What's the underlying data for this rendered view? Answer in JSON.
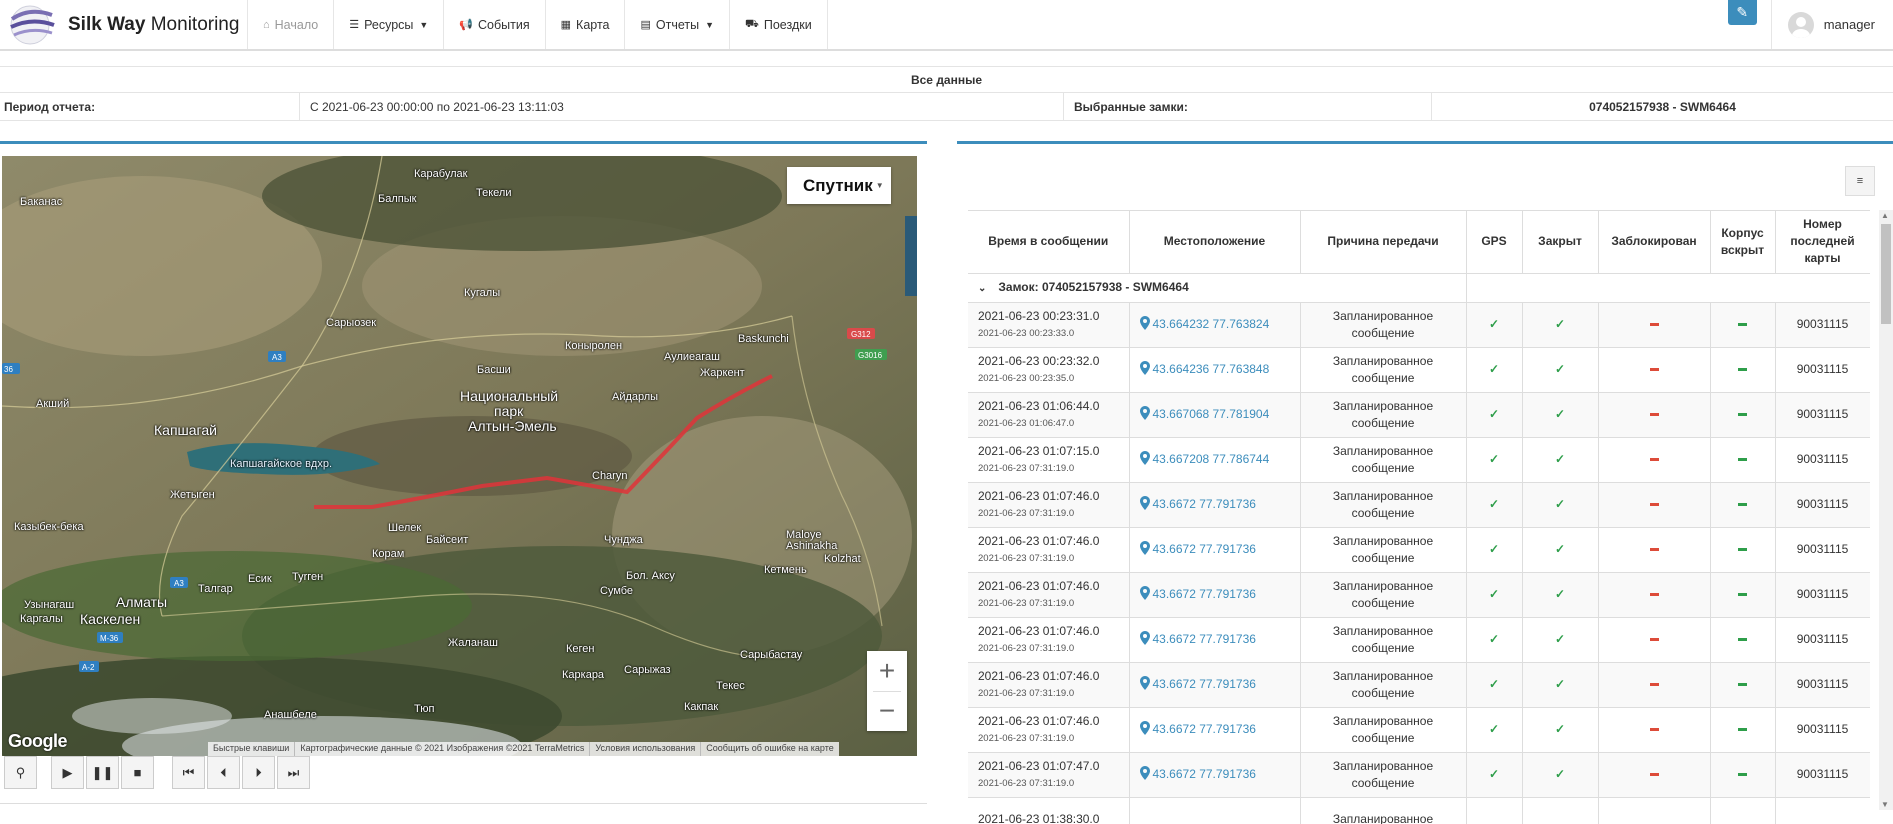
{
  "app": {
    "brand_bold": "Silk Way",
    "brand_rest": " Monitoring"
  },
  "nav": {
    "home": "Начало",
    "resources": "Ресурсы",
    "events": "События",
    "map": "Карта",
    "reports": "Отчеты",
    "trips": "Поездки"
  },
  "user": {
    "name": "manager"
  },
  "report": {
    "heading": "Все данные",
    "period_label": "Период отчета:",
    "period_value": "С 2021-06-23 00:00:00 по 2021-06-23 13:11:03",
    "locks_label": "Выбранные замки:",
    "locks_value": "074052157938 - SWM6464"
  },
  "map": {
    "type_label": "Спутник",
    "zoom_in": "+",
    "zoom_out": "−",
    "google": "Google",
    "attribution": [
      "Быстрые клавиши",
      "Картографические данные © 2021 Изображения ©2021 TerraMetrics",
      "Условия использования",
      "Сообщить об ошибке на карте"
    ],
    "labels": {
      "l1": "Карабулак",
      "l2": "Балпык",
      "l3": "Текели",
      "l4": "Баканас",
      "l5": "Кугалы",
      "l6": "Сарыозек",
      "l7": "Коныролен",
      "l8": "Аулиеагаш",
      "l9": "Baskunchi",
      "l10": "Жаркент",
      "l11": "Басши",
      "l12": "Айдарлы",
      "l13": "Национальный",
      "l14": "парк",
      "l15": "Алтын-Эмель",
      "l16": "Капшагай",
      "l17": "Акший",
      "l18": "Капшагайское вдхр.",
      "l19": "Жетыген",
      "l20": "Казыбек-бека",
      "l21": "Шелек",
      "l22": "Байсеит",
      "l23": "Charyn",
      "l24": "Чунджа",
      "l25": "Корам",
      "l26": "Maloye Ashinakha",
      "l27": "Kolzhat",
      "l28": "Туrген",
      "l29": "Есик",
      "l30": "Талгар",
      "l31": "Кетмень",
      "l32": "Бол. Аксу",
      "l33": "Сумбе",
      "l34": "Алматы",
      "l35": "Узынагаш",
      "l36": "Каргалы",
      "l37": "Каскелен",
      "l38": "Жаланаш",
      "l39": "Кеген",
      "l40": "Каркара",
      "l41": "Сарыжаз",
      "l42": "Сарыбастау",
      "l43": "Текес",
      "l44": "Какпак",
      "l45": "Тюп",
      "l46": "Анашбеле"
    },
    "road_badges": [
      "A3",
      "A3",
      "M-36",
      "A-2",
      "G312",
      "G3016",
      "36"
    ]
  },
  "player": {
    "buttons": [
      "pin",
      "play",
      "pause",
      "stop",
      "first",
      "prev",
      "next",
      "last"
    ]
  },
  "table": {
    "columns": [
      "Время в сообщении",
      "Местоположение",
      "Причина передачи",
      "GPS",
      "Закрыт",
      "Заблокирован",
      "Корпус вскрыт",
      "Номер последней карты"
    ],
    "group_label": "Замок: 074052157938 - SWM6464",
    "rows": [
      {
        "t1": "2021-06-23 00:23:31.0",
        "t2": "2021-06-23 00:23:33.0",
        "loc": "43.664232 77.763824",
        "reason1": "Запланированное",
        "reason2": "сообщение",
        "card": "90031115"
      },
      {
        "t1": "2021-06-23 00:23:32.0",
        "t2": "2021-06-23 00:23:35.0",
        "loc": "43.664236 77.763848",
        "reason1": "Запланированное",
        "reason2": "сообщение",
        "card": "90031115"
      },
      {
        "t1": "2021-06-23 01:06:44.0",
        "t2": "2021-06-23 01:06:47.0",
        "loc": "43.667068 77.781904",
        "reason1": "Запланированное",
        "reason2": "сообщение",
        "card": "90031115"
      },
      {
        "t1": "2021-06-23 01:07:15.0",
        "t2": "2021-06-23 07:31:19.0",
        "loc": "43.667208 77.786744",
        "reason1": "Запланированное",
        "reason2": "сообщение",
        "card": "90031115"
      },
      {
        "t1": "2021-06-23 01:07:46.0",
        "t2": "2021-06-23 07:31:19.0",
        "loc": "43.6672 77.791736",
        "reason1": "Запланированное",
        "reason2": "сообщение",
        "card": "90031115"
      },
      {
        "t1": "2021-06-23 01:07:46.0",
        "t2": "2021-06-23 07:31:19.0",
        "loc": "43.6672 77.791736",
        "reason1": "Запланированное",
        "reason2": "сообщение",
        "card": "90031115"
      },
      {
        "t1": "2021-06-23 01:07:46.0",
        "t2": "2021-06-23 07:31:19.0",
        "loc": "43.6672 77.791736",
        "reason1": "Запланированное",
        "reason2": "сообщение",
        "card": "90031115"
      },
      {
        "t1": "2021-06-23 01:07:46.0",
        "t2": "2021-06-23 07:31:19.0",
        "loc": "43.6672 77.791736",
        "reason1": "Запланированное",
        "reason2": "сообщение",
        "card": "90031115"
      },
      {
        "t1": "2021-06-23 01:07:46.0",
        "t2": "2021-06-23 07:31:19.0",
        "loc": "43.6672 77.791736",
        "reason1": "Запланированное",
        "reason2": "сообщение",
        "card": "90031115"
      },
      {
        "t1": "2021-06-23 01:07:46.0",
        "t2": "2021-06-23 07:31:19.0",
        "loc": "43.6672 77.791736",
        "reason1": "Запланированное",
        "reason2": "сообщение",
        "card": "90031115"
      },
      {
        "t1": "2021-06-23 01:07:47.0",
        "t2": "2021-06-23 07:31:19.0",
        "loc": "43.6672 77.791736",
        "reason1": "Запланированное",
        "reason2": "сообщение",
        "card": "90031115"
      },
      {
        "t1": "2021-06-23 01:38:30.0",
        "t2": "",
        "loc": "",
        "reason1": "Запланированное",
        "reason2": "",
        "card": ""
      }
    ]
  },
  "colors": {
    "accent": "#3c8dbc",
    "ok": "#2e9e4a",
    "bad": "#dd4b39",
    "route": "#e0343a"
  }
}
